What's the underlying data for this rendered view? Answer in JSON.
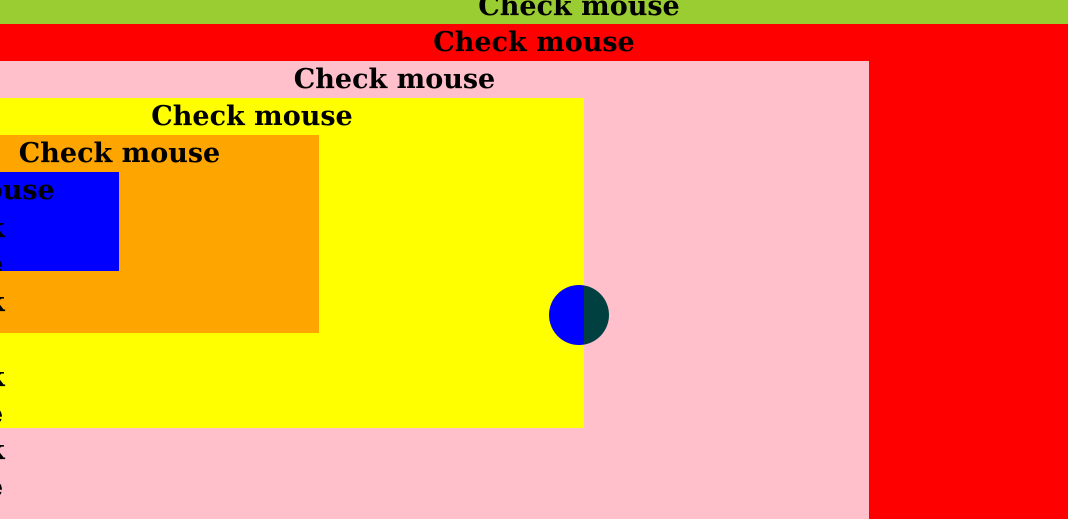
{
  "layers": {
    "green": {
      "label": "Check mouse",
      "color": "#9acd32"
    },
    "red": {
      "label": "Check mouse",
      "color": "#ff0000"
    },
    "pink": {
      "label": "Check mouse",
      "color": "#ffc0cb"
    },
    "yellow": {
      "label": "Check mouse",
      "color": "#ffff00"
    },
    "orange": {
      "label": "Check mouse",
      "color": "#ffa500"
    },
    "blue": {
      "label": "k mouse",
      "color": "#0000ff"
    }
  },
  "left_fragments": [
    "k",
    "e",
    "k",
    "e",
    "k",
    "e",
    "k",
    "e"
  ],
  "cursor_indicator": {
    "left_color": "#0000ff",
    "right_color": "#004040"
  }
}
